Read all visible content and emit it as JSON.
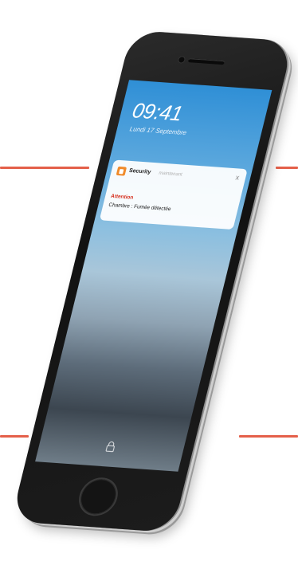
{
  "lockscreen": {
    "time": "09:41",
    "date": "Lundi 17 Septembre"
  },
  "notification": {
    "app_name": "Security",
    "time_ago": "maintenant",
    "close_label": "x",
    "title": "Attention",
    "body": "Chambre : Fumée détectée"
  },
  "icons": {
    "app": "shield-icon",
    "close": "close-icon",
    "lock": "lock-icon",
    "home": "home-button"
  },
  "colors": {
    "accent_line": "#e4604a",
    "app_icon": "#f08a2a",
    "alert_title": "#d6301f"
  }
}
